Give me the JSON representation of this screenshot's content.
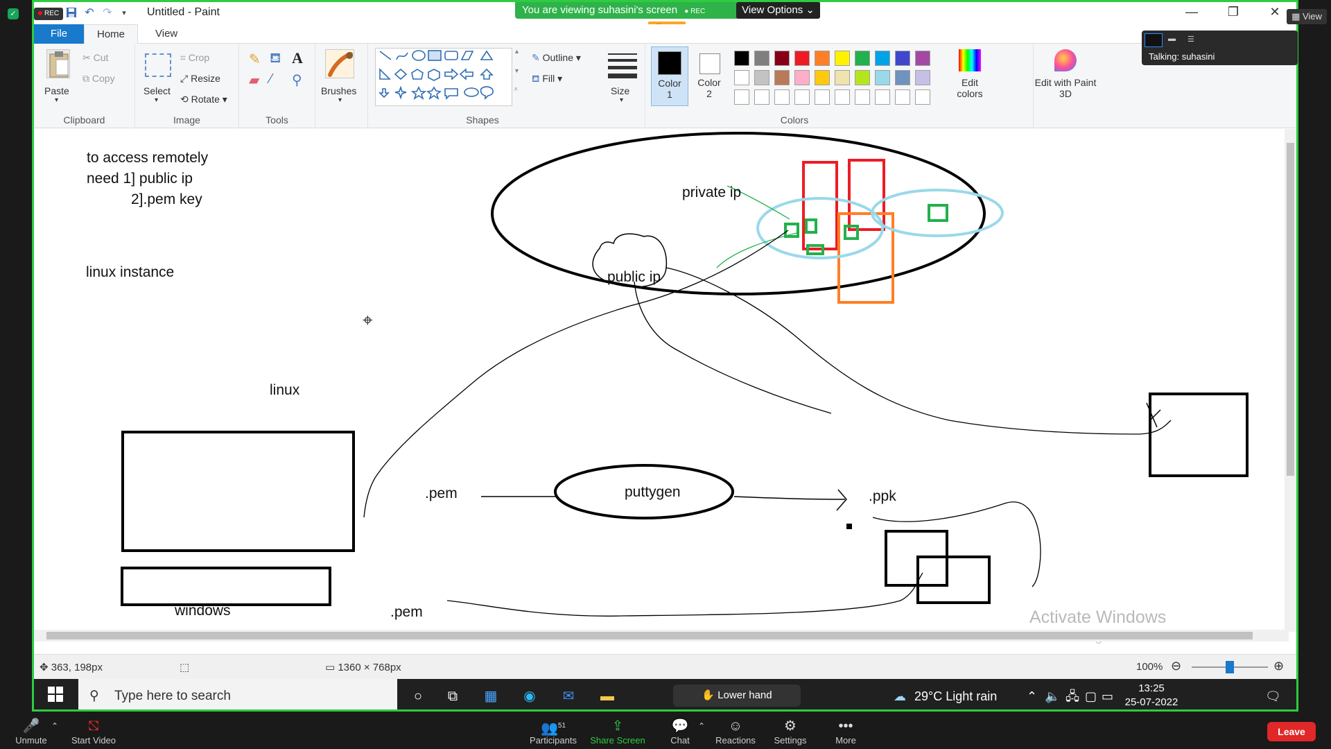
{
  "titlebar": {
    "rec": "REC",
    "window_title": "Untitled - Paint",
    "viewing_banner": "You are viewing suhasini's screen",
    "banner_rec": "REC",
    "view_options": "View Options"
  },
  "ribbon_tabs": {
    "file": "File",
    "home": "Home",
    "view": "View"
  },
  "ribbon": {
    "clipboard": {
      "paste": "Paste",
      "cut": "Cut",
      "copy": "Copy",
      "label": "Clipboard"
    },
    "image": {
      "select": "Select",
      "crop": "Crop",
      "resize": "Resize",
      "rotate": "Rotate",
      "label": "Image"
    },
    "tools": {
      "label": "Tools"
    },
    "brushes": "Brushes",
    "shapes": {
      "outline": "Outline",
      "fill": "Fill",
      "label": "Shapes"
    },
    "size": "Size",
    "color1": "Color 1",
    "color2": "Color 2",
    "colors_label": "Colors",
    "edit_colors": "Edit colors",
    "edit_paint3d": "Edit with Paint 3D",
    "palette_row1": [
      "#000000",
      "#7f7f7f",
      "#880015",
      "#ed1c24",
      "#ff7f27",
      "#fff200",
      "#22b14c",
      "#00a2e8",
      "#3f48cc",
      "#a349a4"
    ],
    "palette_row2": [
      "#ffffff",
      "#c3c3c3",
      "#b97a57",
      "#ffaec9",
      "#ffc90e",
      "#efe4b0",
      "#b5e61d",
      "#99d9ea",
      "#7092be",
      "#c8bfe7"
    ]
  },
  "canvas_text": {
    "line1": "to access  remotely",
    "line2": "need  1] public ip",
    "line3": "2].pem key",
    "linux_instance": "linux  instance",
    "private_ip": "private ip",
    "public_ip": "public ip",
    "linux": "linux",
    "pem1": ".pem",
    "puttygen": "puttygen",
    "ppk": ".ppk",
    "windows": "windows",
    "pem2": ".pem"
  },
  "activation": {
    "title": "Activate Windows",
    "subtitle": "Go to Settings to activate Windows."
  },
  "statusbar": {
    "cursor_pos": "363, 198px",
    "image_size": "1360 × 768px",
    "zoom": "100%",
    "zoom_fraction": 0.5
  },
  "taskbar": {
    "search_placeholder": "Type here to search",
    "lower_hand": "Lower hand",
    "weather": "29°C  Light rain",
    "time": "13:25",
    "date": "25-07-2022"
  },
  "speaker": {
    "talking": "Talking: suhasini",
    "view_button": "View"
  },
  "zoom_bar": {
    "unmute": "Unmute",
    "start_video": "Start Video",
    "participants": "Participants",
    "participants_count": "51",
    "share_screen": "Share Screen",
    "chat": "Chat",
    "reactions": "Reactions",
    "settings": "Settings",
    "more": "More",
    "leave": "Leave"
  }
}
